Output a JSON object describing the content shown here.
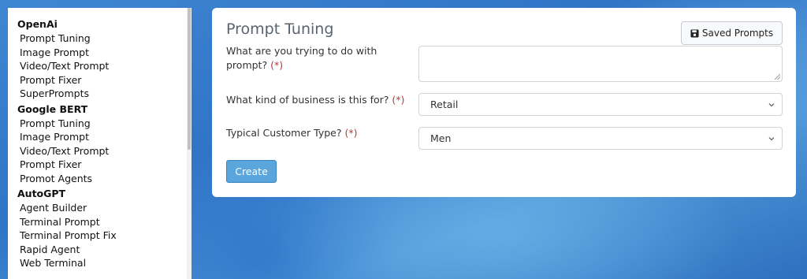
{
  "sidebar": {
    "groups": [
      {
        "heading": "OpenAi",
        "items": [
          "Prompt Tuning",
          "Image Prompt",
          "Video/Text Prompt",
          "Prompt Fixer",
          "SuperPrompts"
        ]
      },
      {
        "heading": "Google BERT",
        "items": [
          "Prompt Tuning",
          "Image Prompt",
          "Video/Text Prompt",
          "Prompt Fixer",
          "Promot Agents"
        ]
      },
      {
        "heading": "AutoGPT",
        "items": [
          "Agent Builder",
          "Terminal Prompt",
          "Terminal Prompt Fix",
          "Rapid Agent",
          "Web Terminal"
        ]
      }
    ]
  },
  "card": {
    "title": "Prompt Tuning",
    "saved_prompts_label": "Saved Prompts",
    "fields": {
      "goal_label": "What are you trying to do with prompt?",
      "goal_value": "",
      "business_label": "What kind of business is this for?",
      "business_value": "Retail",
      "customer_label": "Typical Customer Type?",
      "customer_value": "Men",
      "required_marker": "(*)"
    },
    "create_label": "Create"
  },
  "colors": {
    "primary_button": "#5aa6dc",
    "required_marker": "#b33a3a"
  }
}
